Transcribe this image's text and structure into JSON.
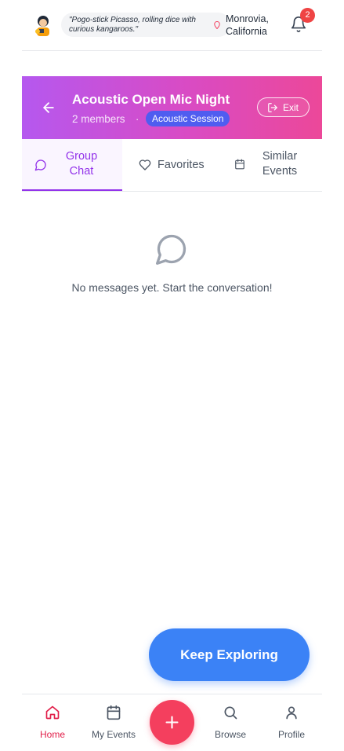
{
  "header": {
    "quote": "\"Pogo-stick Picasso, rolling dice with curious kangaroos.\"",
    "location_line1": "Monrovia,",
    "location_line2": "California",
    "notification_count": "2"
  },
  "event": {
    "title": "Acoustic Open Mic Night",
    "members": "2 members",
    "separator": "·",
    "session_badge": "Acoustic Session",
    "exit_label": "Exit"
  },
  "tabs": [
    {
      "label": "Group Chat",
      "active": true
    },
    {
      "label": "Favorites",
      "active": false
    },
    {
      "label": "Similar Events",
      "active": false
    }
  ],
  "chat": {
    "empty_message": "No messages yet. Start the conversation!"
  },
  "cta": {
    "keep_exploring": "Keep Exploring"
  },
  "bottom_nav": [
    {
      "label": "Home",
      "icon": "home-icon",
      "active": true
    },
    {
      "label": "My Events",
      "icon": "calendar-icon",
      "active": false
    },
    {
      "label": "",
      "icon": "plus-icon",
      "active": false
    },
    {
      "label": "Browse",
      "icon": "search-icon",
      "active": false
    },
    {
      "label": "Profile",
      "icon": "user-icon",
      "active": false
    }
  ],
  "colors": {
    "accent_purple": "#9333ea",
    "banner_start": "#b558ef",
    "banner_end": "#ec4899",
    "session_badge": "#4f5df0",
    "cta_blue": "#3b82f6",
    "fab_pink": "#f43f5e",
    "nav_active": "#e11d48",
    "badge_red": "#ef4444"
  }
}
